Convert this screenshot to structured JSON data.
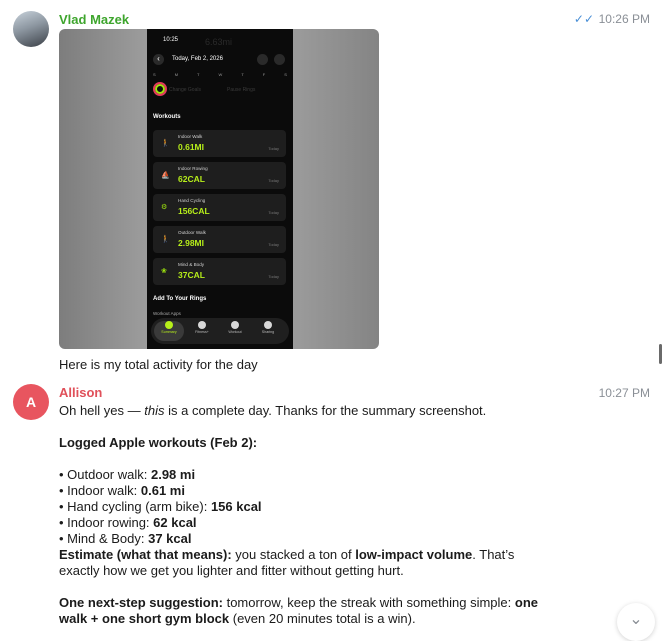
{
  "messages": {
    "vlad": {
      "sender": "Vlad Mazek",
      "time": "10:26 PM",
      "caption": "Here is my total activity for the day",
      "screenshot": {
        "status_time": "10:25",
        "big_value": "6.63mi",
        "nav_date": "Today, Feb 2, 2026",
        "days": [
          "S",
          "M",
          "T",
          "W",
          "T",
          "F",
          "S"
        ],
        "faint_left": "Change Goals",
        "faint_right": "Pause Rings",
        "workouts_title": "Workouts",
        "workouts": [
          {
            "name": "Indoor Walk",
            "value": "0.61MI",
            "day": "Today",
            "icon": "walk-icon"
          },
          {
            "name": "Indoor Rowing",
            "value": "62CAL",
            "day": "Today",
            "icon": "rowing-icon"
          },
          {
            "name": "Hand Cycling",
            "value": "156CAL",
            "day": "Today",
            "icon": "handcycle-icon"
          },
          {
            "name": "Outdoor Walk",
            "value": "2.98MI",
            "day": "Today",
            "icon": "walk-icon"
          },
          {
            "name": "Mind & Body",
            "value": "37CAL",
            "day": "Today",
            "icon": "mind-body-icon"
          }
        ],
        "rings_title": "Add To Your Rings",
        "apps_label": "Workout Apps",
        "tabs": [
          {
            "label": "Summary"
          },
          {
            "label": "Fitness+"
          },
          {
            "label": "Workout"
          },
          {
            "label": "Sharing"
          }
        ]
      }
    },
    "allison": {
      "sender": "Allison",
      "initial": "A",
      "time": "10:27 PM",
      "line1_a": "Oh hell yes — ",
      "line1_em": "this",
      "line1_b": " is a complete day. Thanks for the summary screenshot.",
      "logged_heading": "Logged Apple workouts (Feb 2):",
      "bullets": [
        {
          "label": "• Outdoor walk: ",
          "value": "2.98 mi"
        },
        {
          "label": "• Indoor walk: ",
          "value": "0.61 mi"
        },
        {
          "label": "• Hand cycling (arm bike): ",
          "value": "156 kcal"
        },
        {
          "label": "• Indoor rowing: ",
          "value": "62 kcal"
        },
        {
          "label": "• Mind & Body: ",
          "value": "37 kcal"
        }
      ],
      "estimate_bold": "Estimate (what that means):",
      "estimate_a": " you stacked a ton of ",
      "estimate_b_bold": "low-impact volume",
      "estimate_c": ". That’s",
      "estimate_line2": "exactly how we get you lighter and fitter without getting hurt.",
      "next_bold": "One next-step suggestion:",
      "next_a": " tomorrow, keep the streak with something simple: ",
      "next_b_bold": "one",
      "next_line2_bold": "walk + one short gym block",
      "next_line2": " (even 20 minutes total is a win)."
    }
  }
}
